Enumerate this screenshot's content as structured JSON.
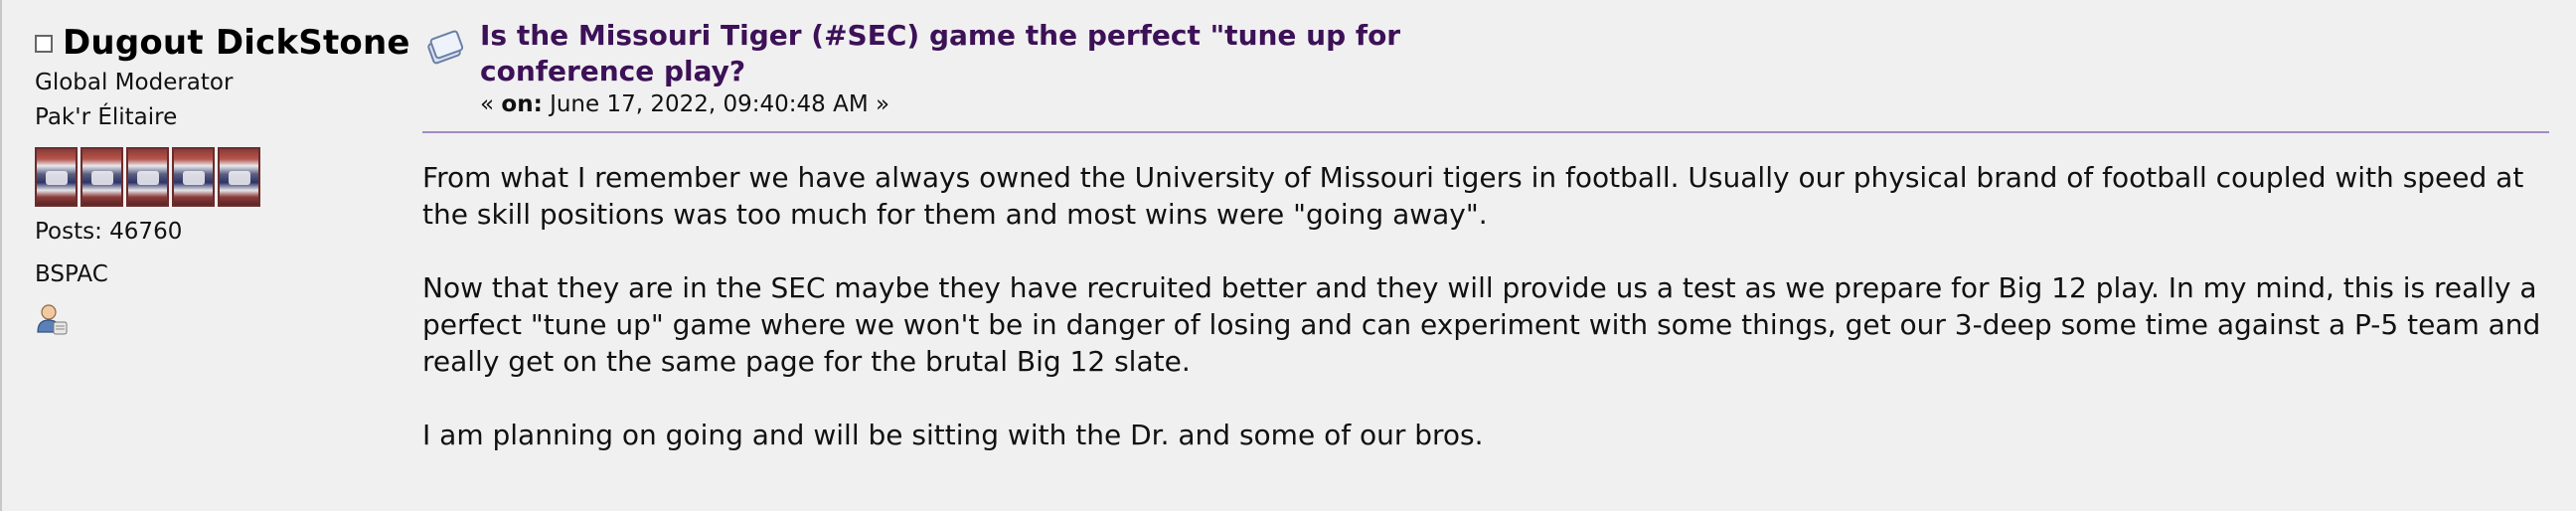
{
  "poster": {
    "name": "Dugout DickStone",
    "title": "Global Moderator",
    "group": "Pak'r Élitaire",
    "star_count": 5,
    "posts_label": "Posts: 46760",
    "custom_field": "BSPAC",
    "status_icon": "offline-checkbox-icon",
    "profile_icon": "user-profile-icon"
  },
  "post": {
    "topic_icon": "topic-xx-icon",
    "subject": "Is the Missouri Tiger (#SEC) game the perfect \"tune up for conference play?",
    "date_prefix": "« ",
    "date_on": "on:",
    "date_value": " June 17, 2022, 09:40:48 AM »",
    "paragraphs": [
      "From what I remember we have always owned the University of Missouri tigers in football.  Usually our physical brand of football coupled with speed at the skill positions was too much for them and most wins were \"going away\".",
      "Now that they are in the SEC maybe they have recruited better and they will provide us a test as we prepare for Big 12 play.  In my mind, this is really a perfect \"tune up\" game where we won't be in danger of losing and can experiment with some things, get our 3-deep some time against a P-5 team and really get on the same page for the brutal Big 12 slate.",
      "I am planning on going and will be sitting with the Dr. and some of our bros."
    ]
  },
  "colors": {
    "background": "#f0f0f0",
    "subject": "#3d1157",
    "divider": "#a38bc4"
  }
}
